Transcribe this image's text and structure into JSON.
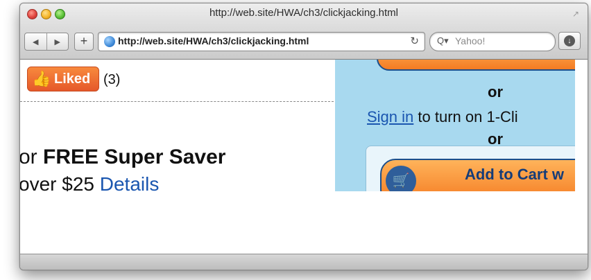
{
  "window": {
    "title": "http://web.site/HWA/ch3/clickjacking.html",
    "address": "http://web.site/HWA/ch3/clickjacking.html",
    "search_placeholder": "Yahoo!",
    "nav": {
      "back_icon": "◀",
      "forward_icon": "▶"
    },
    "add_label": "+",
    "reload_icon": "↻",
    "fullscreen_icon": "↗",
    "download_icon": "↓"
  },
  "left_panel": {
    "like_label": "Liked",
    "like_count": "(3)",
    "free_prefix": "or ",
    "free_bold": "FREE Super Saver",
    "over_prefix": "over $25 ",
    "details_link": "Details"
  },
  "right_panel": {
    "or_text": "or",
    "signin_link": "Sign in",
    "signin_suffix": " to turn on 1-Cli",
    "cart_label": "Add to Cart w"
  },
  "colors": {
    "accent_orange": "#f47b22",
    "panel_blue": "#a8d9ef",
    "link_blue": "#1a56b0"
  },
  "icons": [
    "back-icon",
    "forward-icon",
    "plus-icon",
    "globe-icon",
    "reload-icon",
    "search-icon",
    "download-icon",
    "thumbs-up-icon",
    "cart-icon"
  ]
}
